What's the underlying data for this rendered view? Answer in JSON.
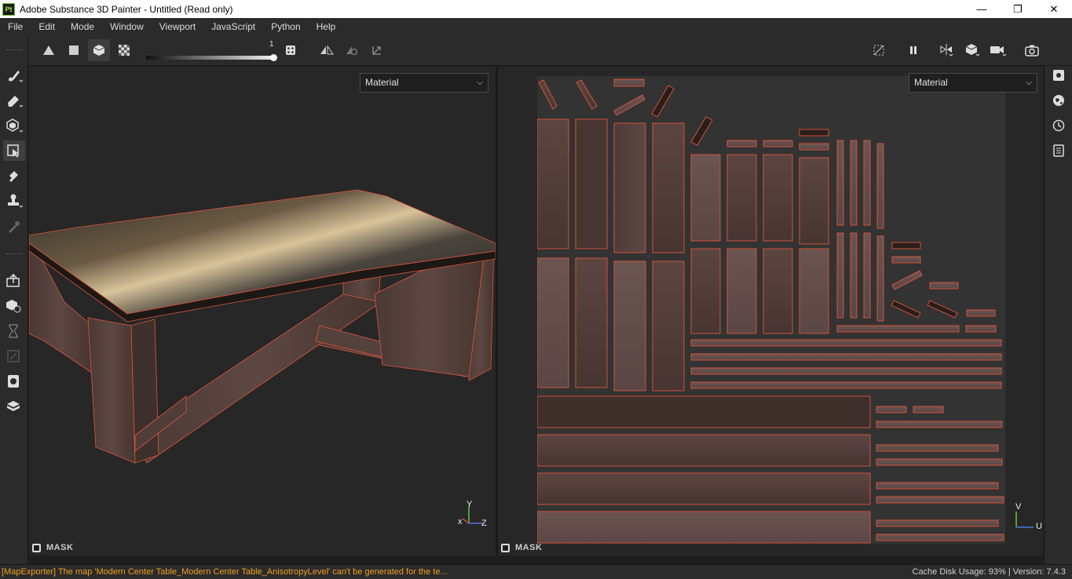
{
  "window": {
    "app_icon": "Pt",
    "title": "Adobe Substance 3D Painter - Untitled (Read only)",
    "controls": [
      "minimize-icon",
      "restore-icon",
      "close-icon"
    ]
  },
  "menu": [
    "File",
    "Edit",
    "Mode",
    "Window",
    "Viewport",
    "JavaScript",
    "Python",
    "Help"
  ],
  "toolbar": {
    "slider_value": "1",
    "left_buttons": [
      "triangle-icon",
      "square-icon",
      "cube-icon",
      "checker-icon"
    ],
    "right_buttons": [
      "hide-icon",
      "pause-icon",
      "split-view-icon",
      "cube-view-icon",
      "camera-icon",
      "screenshot-icon"
    ]
  },
  "viewport3d": {
    "channel_select": "Material",
    "mask_label": "MASK",
    "axes": {
      "y": "Y",
      "x": "x",
      "z": "Z"
    }
  },
  "viewport2d": {
    "channel_select": "Material",
    "mask_label": "MASK",
    "axes": {
      "v": "V",
      "u": "U"
    }
  },
  "status": {
    "message": "[MapExporter] The map 'Modern Center Table_Modern Center Table_AnisotropyLevel' can't be generated for the te...",
    "cache_label": "Cache Disk Usage:",
    "cache_value": "93%",
    "version": "| Version: 7.4.3"
  },
  "colors": {
    "accent_wire": "#e0553a",
    "wood": "#5a4440",
    "status_warning": "#f0a020"
  }
}
